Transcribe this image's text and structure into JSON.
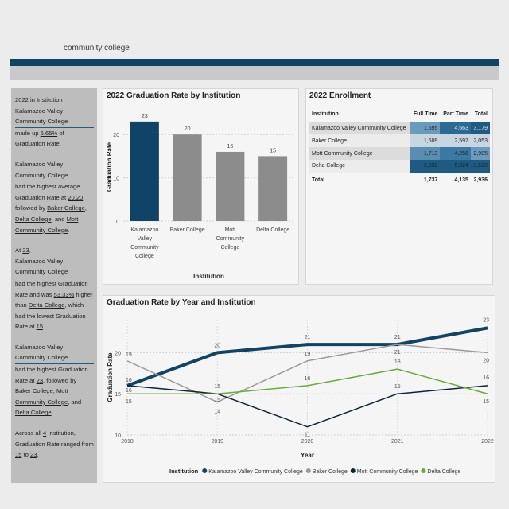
{
  "header": {
    "title": "community college"
  },
  "narrative": {
    "p1": {
      "year": "2022",
      "a": " in Institution",
      "inst": "Kalamazoo Valley Community College",
      "b": "made up ",
      "pct": "6.65%",
      "c": " of Graduation Rate."
    },
    "p2": {
      "inst": "Kalamazoo Valley Community College",
      "a": "had the highest average Graduation Rate at ",
      "val": "20.20",
      "b": ", followed by ",
      "i2": "Baker College",
      "c": ", ",
      "i3": "Delta College",
      "d": ", and ",
      "i4": "Mott Community College",
      "e": "."
    },
    "p3": {
      "a": "At ",
      "val": "23",
      "b": ",",
      "inst": "Kalamazoo Valley Community College",
      "c": "had the highest Graduation Rate and was ",
      "pct": "53.33%",
      "d": " higher than ",
      "i2": "Delta College",
      "e": ", which had the lowest Graduation Rate at ",
      "low": "15",
      "f": "."
    },
    "p4": {
      "inst": "Kalamazoo Valley Community College",
      "a": "had the highest Graduation Rate at ",
      "val": "23",
      "b": ", followed by ",
      "i2": "Baker College",
      "c": ", ",
      "i3": "Mott Community College",
      "d": ", and ",
      "i4": "Delta College",
      "e": "."
    },
    "p5": {
      "a": "Across all ",
      "n": "4",
      "b": " Institution, Graduation Rate ranged from ",
      "lo": "15",
      "c": " to ",
      "hi": "23",
      "d": "."
    }
  },
  "enrollment": {
    "title": "2022 Enrollment",
    "headers": [
      "Institution",
      "Full Time",
      "Part Time",
      "Total"
    ],
    "rows": [
      {
        "name": "Kalamazoo Valley Community College",
        "ft": "1,695",
        "pt": "4,663",
        "tot": "3,179"
      },
      {
        "name": "Baker College",
        "ft": "1,509",
        "pt": "2,597",
        "tot": "2,053"
      },
      {
        "name": "Mott Community College",
        "ft": "1,713",
        "pt": "4,256",
        "tot": "2,985"
      },
      {
        "name": "Delta College",
        "ft": "2,032",
        "pt": "5,024",
        "tot": "3,528"
      }
    ],
    "total": {
      "name": "Total",
      "ft": "1,737",
      "pt": "4,135",
      "tot": "2,936"
    },
    "colors": {
      "dark": "#1f5a80",
      "mid": "#6a9bbd",
      "light": "#c8d6e2"
    }
  },
  "chart_data": [
    {
      "type": "bar",
      "title": "2022 Graduation Rate by Institution",
      "xlabel": "Institution",
      "ylabel": "Graduation Rate",
      "categories": [
        "Kalamazoo Valley Community College",
        "Baker College",
        "Mott Community College",
        "Delta College"
      ],
      "values": [
        23,
        20,
        16,
        15
      ],
      "ylim": [
        0,
        25
      ],
      "yticks": [
        0,
        10,
        20
      ],
      "colors": [
        "#0f4466",
        "#8c8c8c",
        "#8c8c8c",
        "#8c8c8c"
      ],
      "grid": true
    },
    {
      "type": "line",
      "title": "Graduation Rate by Year and Institution",
      "xlabel": "Year",
      "ylabel": "Graduation Rate",
      "x": [
        "2018",
        "2019",
        "2020",
        "2021",
        "2022"
      ],
      "ylim": [
        10,
        24
      ],
      "yticks": [
        10,
        15,
        20
      ],
      "grid": true,
      "legend_title": "Institution",
      "series": [
        {
          "name": "Kalamazoo Valley Community College",
          "values": [
            16,
            20,
            21,
            21,
            23
          ],
          "color": "#0f4466"
        },
        {
          "name": "Baker College",
          "values": [
            19,
            14,
            19,
            21,
            20
          ],
          "color": "#9a9a9a"
        },
        {
          "name": "Mott Community College",
          "values": [
            16,
            15,
            11,
            15,
            16
          ],
          "color": "#0d2433"
        },
        {
          "name": "Delta College",
          "values": [
            15,
            15,
            16,
            18,
            15
          ],
          "color": "#6aaa3a"
        }
      ]
    }
  ]
}
